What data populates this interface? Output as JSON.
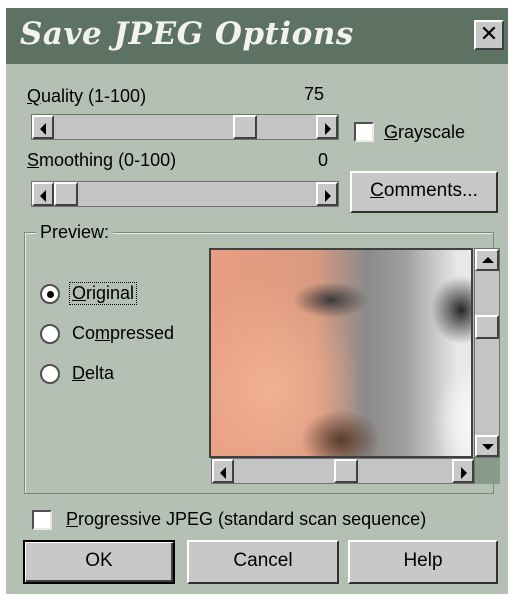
{
  "window": {
    "title": "Save JPEG Options",
    "close_glyph": "✕"
  },
  "quality": {
    "label_hotkey": "Q",
    "label_rest": "uality (1-100)",
    "value": "75",
    "level_fraction": 0.75
  },
  "smoothing": {
    "label_hotkey": "S",
    "label_rest": "moothing (0-100)",
    "value": "0",
    "level_fraction": 0.0
  },
  "grayscale": {
    "label_hotkey": "G",
    "label_rest": "rayscale",
    "checked": false
  },
  "comments_button": {
    "label_hotkey": "C",
    "label_rest": "omments..."
  },
  "preview": {
    "legend": "Preview:",
    "options": [
      {
        "hotkey": "O",
        "rest": "riginal",
        "pre": "",
        "selected": true
      },
      {
        "pre": "Co",
        "hotkey": "m",
        "rest": "pressed",
        "selected": false
      },
      {
        "hotkey": "D",
        "rest": "elta",
        "pre": "",
        "selected": false
      }
    ]
  },
  "progressive": {
    "label_hotkey": "P",
    "label_rest": "rogressive JPEG (standard scan sequence)",
    "checked": false
  },
  "buttons": {
    "ok": "OK",
    "cancel": "Cancel",
    "help": "Help"
  }
}
